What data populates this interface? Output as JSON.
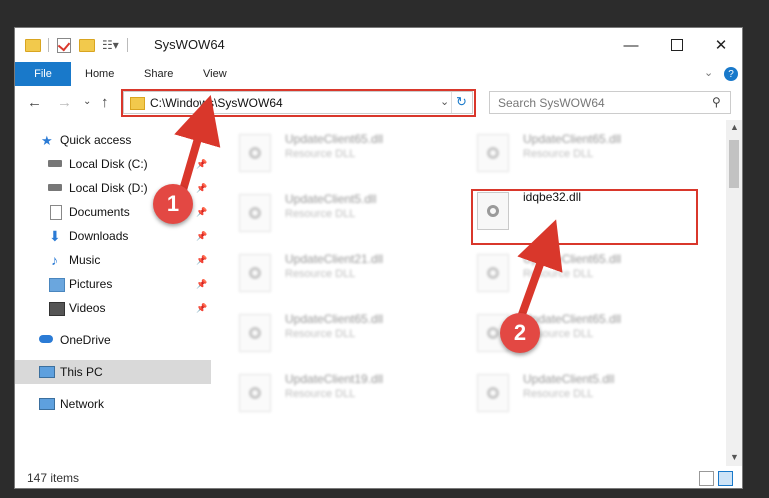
{
  "window": {
    "title": "SysWOW64",
    "minimize_icon": "minimize-icon",
    "maximize_icon": "maximize-icon",
    "close_icon": "close-icon"
  },
  "ribbon": {
    "tabs": [
      "File",
      "Home",
      "Share",
      "View"
    ]
  },
  "address": {
    "path": "C:\\Windows\\SysWOW64",
    "search_placeholder": "Search SysWOW64"
  },
  "nav": {
    "quick_access": "Quick access",
    "items": [
      "Local Disk (C:)",
      "Local Disk (D:)",
      "Documents",
      "Downloads",
      "Music",
      "Pictures",
      "Videos"
    ],
    "onedrive": "OneDrive",
    "this_pc": "This PC",
    "network": "Network"
  },
  "files": [
    {
      "name": "UpdateClient65.dll",
      "type": "Resource DLL"
    },
    {
      "name": "UpdateClient65.dll",
      "type": "Resource DLL"
    },
    {
      "name": "UpdateClient5.dll",
      "type": "Resource DLL"
    },
    {
      "name": "idqbe32.dll",
      "type": ""
    },
    {
      "name": "UpdateClient21.dll",
      "type": "Resource DLL"
    },
    {
      "name": "UpdateClient65.dll",
      "type": "Resource DLL"
    },
    {
      "name": "UpdateClient65.dll",
      "type": "Resource DLL"
    },
    {
      "name": "UpdateClient65.dll",
      "type": "Resource DLL"
    },
    {
      "name": "UpdateClient19.dll",
      "type": "Resource DLL"
    },
    {
      "name": "UpdateClient5.dll",
      "type": "Resource DLL"
    }
  ],
  "status": {
    "items": "147 items"
  },
  "annotations": {
    "step1": "1",
    "step2": "2",
    "highlight_color": "#d9372b"
  }
}
